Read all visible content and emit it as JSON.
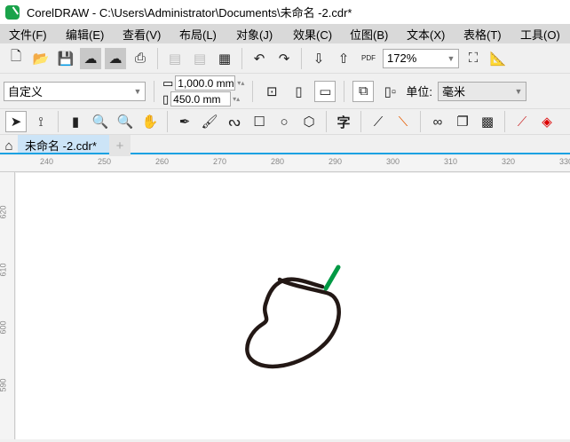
{
  "title": "CorelDRAW - C:\\Users\\Administrator\\Documents\\未命名 -2.cdr*",
  "menu": [
    "文件(F)",
    "编辑(E)",
    "查看(V)",
    "布局(L)",
    "对象(J)",
    "效果(C)",
    "位图(B)",
    "文本(X)",
    "表格(T)",
    "工具(O)"
  ],
  "toolbar": {
    "zoom": "172%",
    "pdf_label": "PDF"
  },
  "property_bar": {
    "page_preset": "自定义",
    "width": "1,000.0 mm",
    "height": "450.0 mm",
    "units_label": "单位:",
    "units": "毫米"
  },
  "toolbox_icons": [
    "pick-tool",
    "shape-tool",
    "crop-tool",
    "zoom-tool",
    "zoom-out-tool",
    "pan-tool",
    "pen-tool",
    "brush-tool",
    "curve-tool",
    "rectangle-tool",
    "ellipse-tool",
    "polygon-tool",
    "text-tool",
    "line-tool",
    "connector-tool",
    "blend-tool",
    "shadow-tool",
    "transparency-tool",
    "eyedropper-tool",
    "fill-tool"
  ],
  "text_tool_glyph": "字",
  "tabs": [
    {
      "label": "未命名 -2.cdr*"
    }
  ],
  "ruler": {
    "h": [
      "240",
      "250",
      "260",
      "270",
      "280",
      "290",
      "300",
      "310",
      "320",
      "330"
    ],
    "v": [
      "620",
      "610",
      "600",
      "590"
    ]
  },
  "colors": {
    "shape_stroke": "#231815",
    "stem": "#009944",
    "accent": "#1ba1e2"
  }
}
